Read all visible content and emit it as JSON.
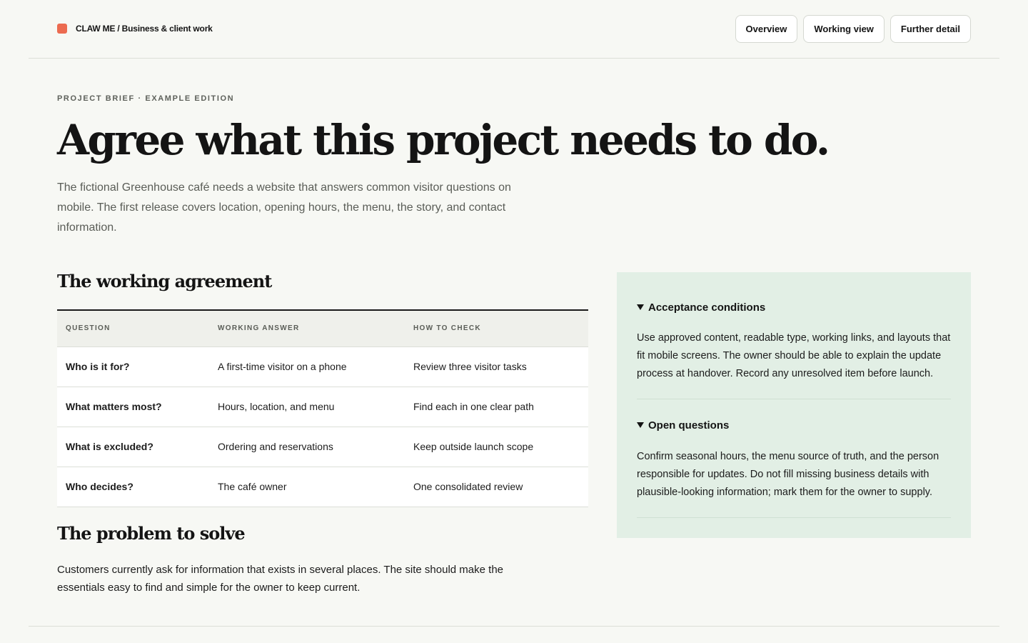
{
  "header": {
    "brand": "CLAW ME / Business & client work",
    "nav": [
      "Overview",
      "Working view",
      "Further detail"
    ]
  },
  "hero": {
    "eyebrow": "PROJECT BRIEF · EXAMPLE EDITION",
    "title": "Agree what this project needs to do.",
    "lede": "The fictional Greenhouse café needs a website that answers common visitor questions on mobile. The first release covers location, opening hours, the menu, the story, and contact information."
  },
  "agreement": {
    "title": "The working agreement",
    "columns": [
      "QUESTION",
      "WORKING ANSWER",
      "HOW TO CHECK"
    ],
    "rows": [
      [
        "Who is it for?",
        "A first-time visitor on a phone",
        "Review three visitor tasks"
      ],
      [
        "What matters most?",
        "Hours, location, and menu",
        "Find each in one clear path"
      ],
      [
        "What is excluded?",
        "Ordering and reservations",
        "Keep outside launch scope"
      ],
      [
        "Who decides?",
        "The café owner",
        "One consolidated review"
      ]
    ]
  },
  "problem": {
    "title": "The problem to solve",
    "text": "Customers currently ask for information that exists in several places. The site should make the essentials easy to find and simple for the owner to keep current."
  },
  "panel": {
    "sections": [
      {
        "summary": "Acceptance conditions",
        "body": "Use approved content, readable type, working links, and layouts that fit mobile screens. The owner should be able to explain the update process at handover. Record any unresolved item before launch."
      },
      {
        "summary": "Open questions",
        "body": "Confirm seasonal hours, the menu source of truth, and the person responsible for updates. Do not fill missing business details with plausible-looking information; mark them for the owner to supply."
      }
    ]
  },
  "colors": {
    "brand_mark": "#ec6b50",
    "panel_bg": "#e2efe5",
    "page_bg": "#f7f8f4"
  }
}
